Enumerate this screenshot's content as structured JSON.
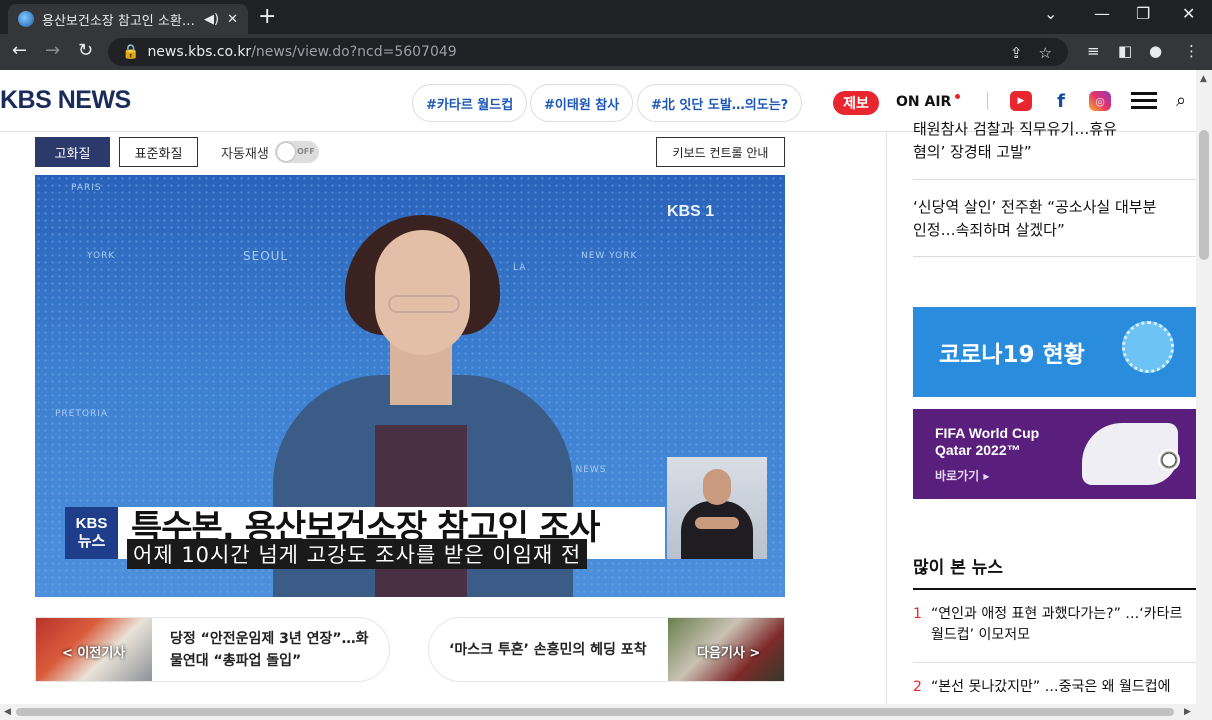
{
  "browser": {
    "tab_title": "용산보건소장 참고인 소환…",
    "tab_sound_icon": "speaker-icon",
    "tab_close": "✕",
    "new_tab": "+",
    "url_host": "news.kbs.co.kr",
    "url_path": "/news/view.do?ncd=5607049"
  },
  "header": {
    "logo": "KBS NEWS",
    "tags": [
      "#카타르 월드컵",
      "#이태원 참사",
      "#北 잇단 도발…의도는?"
    ],
    "tip_label": "제보",
    "onair_label": "ON AIR"
  },
  "player": {
    "quality_high": "고화질",
    "quality_std": "표준화질",
    "autoplay_label": "자동재생",
    "autoplay_state": "OFF",
    "keyboard_guide": "키보드 컨트롤 안내",
    "watermark": "KBS 1",
    "badge_line1": "KBS",
    "badge_line2": "뉴스",
    "headline": "특수본, 용산보건소장 참고인 조사",
    "caption": "어제 10시간 넘게 고강도 조사를 받은 이임재 전",
    "map_cities": [
      "PARIS",
      "SEOUL",
      "YORK",
      "LA",
      "NEW YORK",
      "PRETORIA",
      "KBS NEWS"
    ]
  },
  "article_nav": {
    "prev_label": "< 이전기사",
    "prev_title_line1": "당정 “안전운임제 3년 연장”…화",
    "prev_title_line2": "물연대 “총파업 돌입”",
    "next_label": "다음기사 >",
    "next_title": "‘마스크 투혼’ 손흥민의 헤딩 포착"
  },
  "sidebar": {
    "items": [
      {
        "line1": "태원참사 검찰과 직무유기…휴유",
        "line2": "혐의’ 장경태 고발”"
      },
      {
        "line1": "‘신당역 살인’ 전주환 “공소사실 대부분",
        "line2": "인정…속죄하며 살겠다”"
      }
    ],
    "covid_banner": "코로나19 현황",
    "fifa_line1": "FIFA World Cup",
    "fifa_line2": "Qatar 2022™",
    "fifa_go": "바로가기 ▸",
    "popular_heading": "많이 본 뉴스",
    "popular": [
      {
        "num": "1",
        "line1": "“연인과 애정 표현 과했다가는?” …‘카타르",
        "line2": "월드컵’ 이모저모"
      },
      {
        "num": "2",
        "line1": "“본선 못나갔지만” …중국은 왜 월드컵에",
        "line2": ""
      }
    ]
  }
}
